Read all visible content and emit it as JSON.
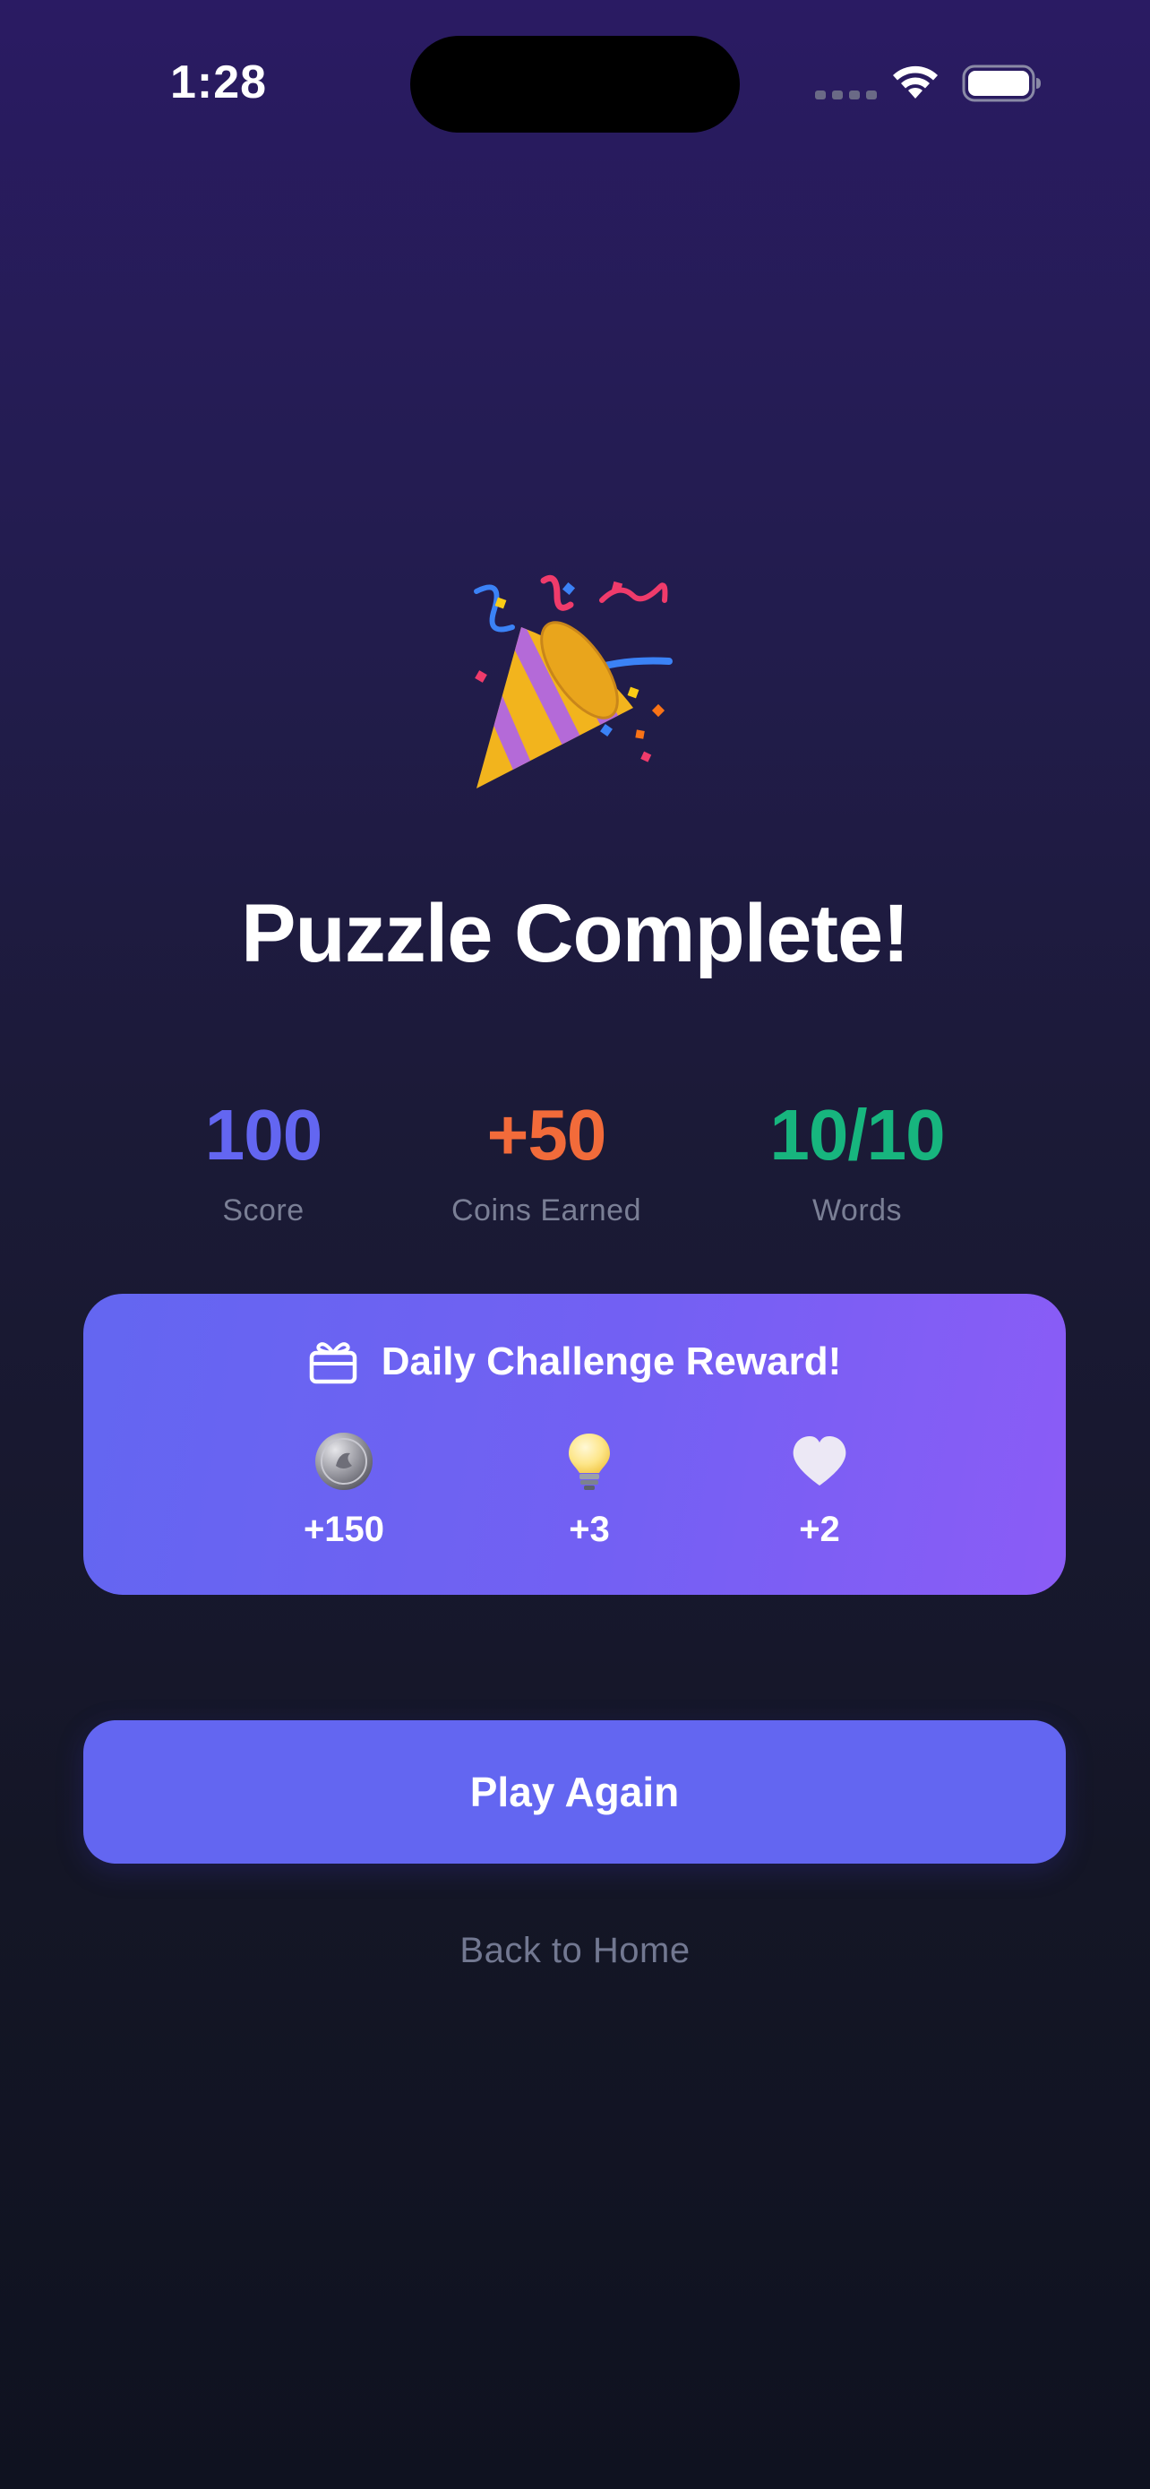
{
  "status_bar": {
    "time": "1:28",
    "icons": [
      "cellular-dots-icon",
      "wifi-icon",
      "battery-icon"
    ]
  },
  "hero": {
    "icon": "party-popper-icon",
    "title": "Puzzle Complete!"
  },
  "stats": [
    {
      "value": "100",
      "label": "Score",
      "color": "#6366f1"
    },
    {
      "value": "+50",
      "label": "Coins Earned",
      "color": "#f26b3a"
    },
    {
      "value": "10/10",
      "label": "Words",
      "color": "#17b57e"
    }
  ],
  "reward": {
    "icon": "gift-icon",
    "title": "Daily Challenge Reward!",
    "items": [
      {
        "icon": "coin-icon",
        "value": "+150"
      },
      {
        "icon": "lightbulb-icon",
        "value": "+3"
      },
      {
        "icon": "heart-icon",
        "value": "+2"
      }
    ],
    "gradient_start": "#6366f1",
    "gradient_end": "#8b5cf6"
  },
  "actions": {
    "play_again_label": "Play Again",
    "back_home_label": "Back to Home",
    "accent": "#6366f1"
  }
}
